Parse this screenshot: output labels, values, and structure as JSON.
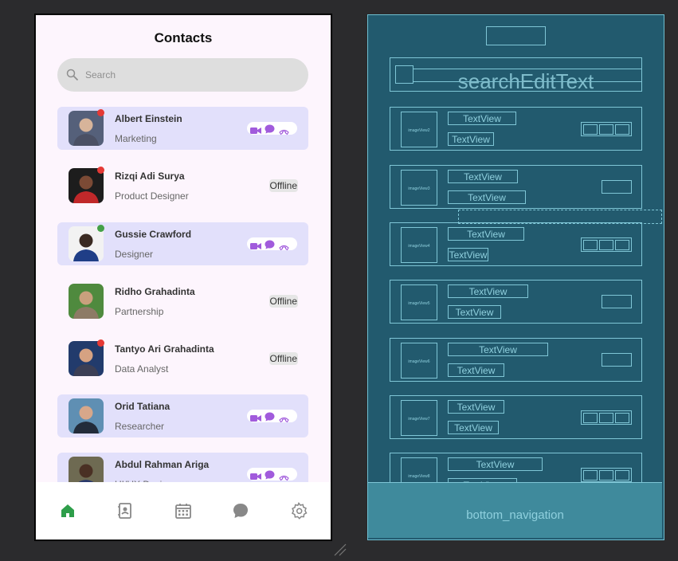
{
  "header": {
    "title": "Contacts"
  },
  "search": {
    "placeholder": "Search"
  },
  "contacts": [
    {
      "name": "Albert Einstein",
      "role": "Marketing",
      "online": true,
      "status_text": "",
      "dot": "#e53935"
    },
    {
      "name": "Rizqi Adi Surya",
      "role": "Product Designer",
      "online": false,
      "status_text": "Offline",
      "dot": "#e53935"
    },
    {
      "name": "Gussie Crawford",
      "role": "Designer",
      "online": true,
      "status_text": "",
      "dot": "#43a047"
    },
    {
      "name": "Ridho Grahadinta",
      "role": "Partnership",
      "online": false,
      "status_text": "Offline",
      "dot": ""
    },
    {
      "name": "Tantyo Ari Grahadinta",
      "role": "Data Analyst",
      "online": false,
      "status_text": "Offline",
      "dot": "#e53935"
    },
    {
      "name": "Orid Tatiana",
      "role": "Researcher",
      "online": true,
      "status_text": "",
      "dot": ""
    },
    {
      "name": "Abdul Rahman Ariga",
      "role": "UI/UX Designer",
      "online": true,
      "status_text": "",
      "dot": ""
    }
  ],
  "bottom_nav": {
    "items": [
      "home-icon",
      "contacts-icon",
      "calendar-icon",
      "chat-icon",
      "settings-icon"
    ],
    "active_color": "#2e9e4a",
    "inactive_color": "#888888"
  },
  "colors": {
    "accent": "#a15bdc",
    "row_highlight": "#e2e0fb"
  },
  "blueprint": {
    "search_label": "searchEditText",
    "textview_label": "TextView",
    "image_views": [
      "imageView2",
      "imageView3",
      "imageView4",
      "imageView5",
      "imageView6",
      "imageView7",
      "imageView8"
    ],
    "bottom_label": "bottom_navigation"
  }
}
